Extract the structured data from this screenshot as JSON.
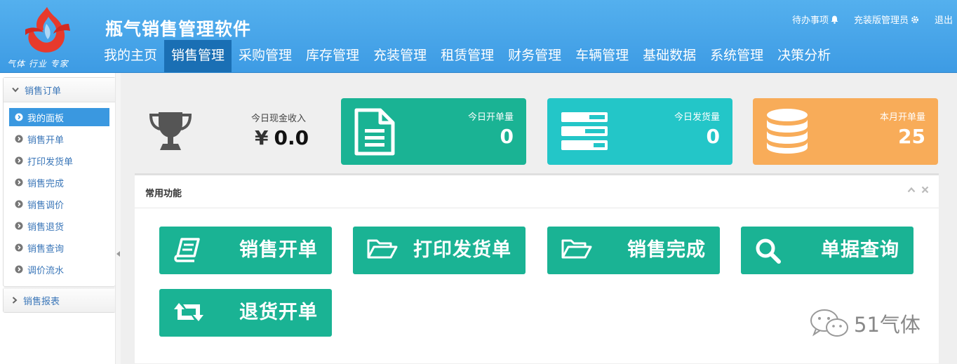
{
  "app": {
    "logo_slogan": "气体 行业 专家",
    "title": "瓶气销售管理软件"
  },
  "top_links": {
    "todo": "待办事项",
    "user": "充装版管理员",
    "logout": "退出"
  },
  "nav": {
    "items": [
      "我的主页",
      "销售管理",
      "采购管理",
      "库存管理",
      "充装管理",
      "租赁管理",
      "财务管理",
      "车辆管理",
      "基础数据",
      "系统管理",
      "决策分析"
    ],
    "active_index": 1
  },
  "sidebar": {
    "group1": {
      "title": "销售订单",
      "items": [
        "我的面板",
        "销售开单",
        "打印发货单",
        "销售完成",
        "销售调价",
        "销售退货",
        "销售查询",
        "调价流水"
      ],
      "active_index": 0
    },
    "group2": {
      "title": "销售报表"
    }
  },
  "stats": {
    "cash": {
      "label": "今日现金收入",
      "currency": "¥",
      "value": "0.0"
    },
    "orders_today": {
      "label": "今日开单量",
      "value": "0",
      "color": "#1ab394"
    },
    "shipped_today": {
      "label": "今日发货量",
      "value": "0",
      "color": "#23c6c8"
    },
    "orders_month": {
      "label": "本月开单量",
      "value": "25",
      "color": "#f8ac59"
    }
  },
  "panel": {
    "title": "常用功能",
    "buttons": [
      {
        "label": "销售开单",
        "icon": "book-icon"
      },
      {
        "label": "打印发货单",
        "icon": "folder-open-icon"
      },
      {
        "label": "销售完成",
        "icon": "folder-open-icon"
      },
      {
        "label": "单据查询",
        "icon": "search-icon"
      },
      {
        "label": "退货开单",
        "icon": "retweet-icon"
      }
    ],
    "button_color": "#1ab394"
  },
  "watermark": {
    "text": "51气体"
  }
}
